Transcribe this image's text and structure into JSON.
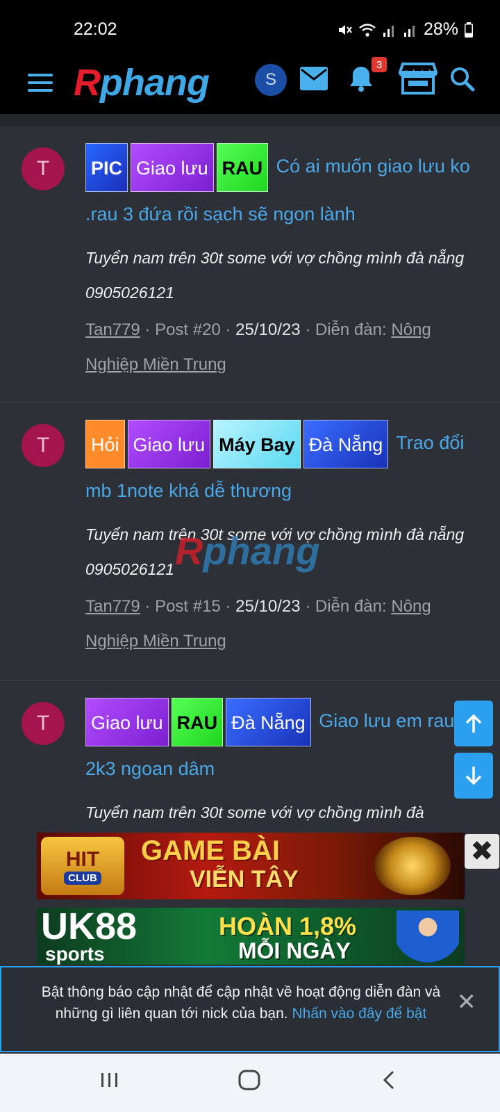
{
  "status_bar": {
    "time": "22:02",
    "battery": "28%",
    "icons": [
      "mute-icon",
      "wifi-icon",
      "signal-icon",
      "signal-icon",
      "battery-icon"
    ]
  },
  "header": {
    "logo_r": "R",
    "logo_rest": "phang",
    "user_initial": "S",
    "notification_count": "3",
    "icons": [
      "menu-icon",
      "mail-icon",
      "bell-icon",
      "store-icon",
      "search-icon"
    ]
  },
  "posts": [
    {
      "avatar_letter": "T",
      "tags": [
        "PIC",
        "Giao lưu",
        "RAU"
      ],
      "title": "Có ai muốn giao lưu ko .rau 3 đứa rồi sạch sẽ ngon lành",
      "snippet": "Tuyển nam trên 30t some với vợ chồng mình đà nẵng 0905026121",
      "author": "Tan779",
      "post_no": "Post #20",
      "date": "25/10/23",
      "forum_label": "Diễn đàn:",
      "forum": "Nông Nghiệp Miền Trung"
    },
    {
      "avatar_letter": "T",
      "tags": [
        "Hỏi",
        "Giao lưu",
        "Máy Bay",
        "Đà Nẵng"
      ],
      "title": "Trao đổi mb 1note khá dễ thương",
      "snippet": "Tuyển nam trên 30t some với vợ chồng mình đà nẵng 0905026121",
      "author": "Tan779",
      "post_no": "Post #15",
      "date": "25/10/23",
      "forum_label": "Diễn đàn:",
      "forum": "Nông Nghiệp Miền Trung"
    },
    {
      "avatar_letter": "T",
      "tags": [
        "Giao lưu",
        "RAU",
        "Đà Nẵng"
      ],
      "title": "Giao lưu em rau 2k3 ngoan dâm",
      "snippet": "Tuyển nam trên 30t some với vợ chồng mình đà"
    }
  ],
  "watermark": {
    "r": "R",
    "rest": "phang"
  },
  "ads": {
    "ad1": {
      "logo": "HIT",
      "logo_sub": "CLUB",
      "line1": "GAME BÀI",
      "line2": "VIỄN TÂY"
    },
    "ad2": {
      "logo": "UK88",
      "logo_sub": "sports",
      "line1": "HOÀN 1,8%",
      "line2": "MỖI NGÀY"
    },
    "close": "✖"
  },
  "notice": {
    "text": "Bật thông báo cập nhật để cập nhật về hoạt động diễn đàn và những gì liên quan tới nick của bạn.",
    "link": "Nhấn vào đây để bật",
    "close": "✕"
  },
  "colors": {
    "background": "#2d3036",
    "link": "#4aa8e8",
    "accent": "#2b9ff0",
    "avatar": "#a3154c"
  }
}
